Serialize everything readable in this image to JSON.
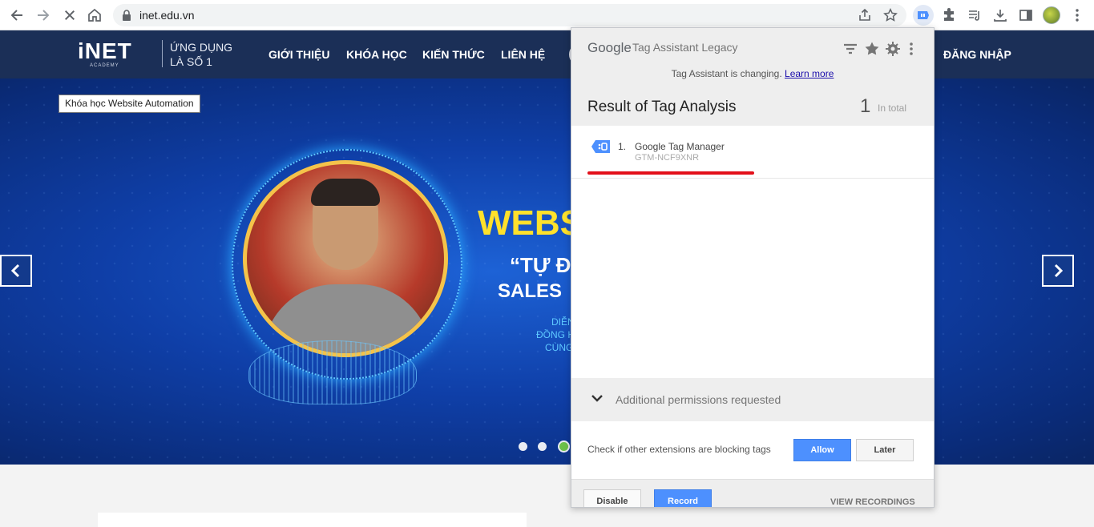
{
  "browser": {
    "url": "inet.edu.vn"
  },
  "site": {
    "logo": "iNET",
    "logo_sub": "ACADEMY",
    "slogan_line1": "ỨNG DỤNG",
    "slogan_line2": "LÀ SỐ 1",
    "nav": [
      "GIỚI THIỆU",
      "KHÓA HỌC",
      "KIẾN THỨC",
      "LIÊN HỆ"
    ],
    "login": "ĐĂNG NHẬP",
    "tooltip": "Khóa học Website Automation",
    "hero": {
      "title_partial": "WEBS",
      "quote_partial": "“TỰ Đ",
      "sales_partial": "SALES",
      "small1": "DIỄN",
      "small2": "ĐỒNG H",
      "small3": "CÙNG"
    },
    "carousel": {
      "slides": 3,
      "active_index": 2
    }
  },
  "extension": {
    "brand": "Google",
    "name": "Tag Assistant Legacy",
    "notice": "Tag Assistant is changing.",
    "notice_link": "Learn more",
    "result_title": "Result of Tag Analysis",
    "count": "1",
    "count_label": "In total",
    "tags": [
      {
        "num": "1.",
        "name": "Google Tag Manager",
        "id": "GTM-NCF9XNR"
      }
    ],
    "permissions": "Additional permissions requested",
    "check_text": "Check if other extensions are blocking tags",
    "allow": "Allow",
    "later": "Later",
    "disable": "Disable",
    "record": "Record",
    "view_recordings": "VIEW RECORDINGS",
    "colors": {
      "primary_button": "#4d90fe",
      "highlight_line": "#e3101a"
    }
  }
}
